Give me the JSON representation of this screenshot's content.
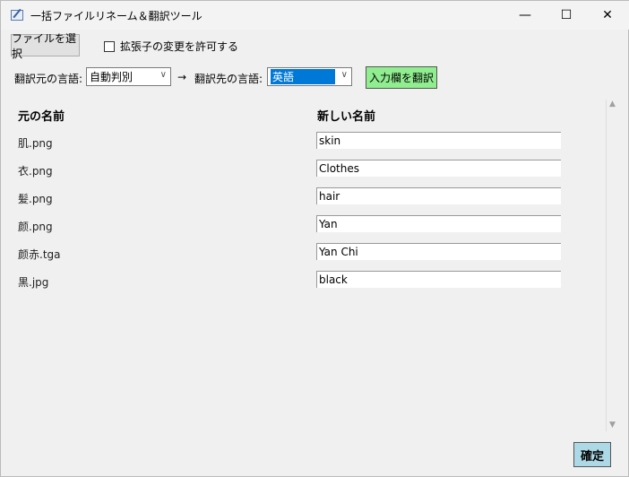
{
  "window": {
    "title": "一括ファイルリネーム＆翻訳ツール",
    "minimize": "—",
    "maximize": "☐",
    "close": "✕"
  },
  "toolbar": {
    "select_file": "ファイルを選択",
    "allow_ext_change": "拡張子の変更を許可する",
    "allow_ext_checked": false
  },
  "translate": {
    "source_label": "翻訳元の言語:",
    "source_value": "自動判別",
    "arrow": "→",
    "target_label": "翻訳先の言語:",
    "target_value": "英語",
    "translate_button": "入力欄を翻訳"
  },
  "table": {
    "header_original": "元の名前",
    "header_new": "新しい名前",
    "rows": [
      {
        "original": "肌.png",
        "new": "skin"
      },
      {
        "original": "衣.png",
        "new": "Clothes"
      },
      {
        "original": "髪.png",
        "new": "hair"
      },
      {
        "original": "颜.png",
        "new": "Yan"
      },
      {
        "original": "颜赤.tga",
        "new": "Yan Chi"
      },
      {
        "original": "黒.jpg",
        "new": "black"
      }
    ]
  },
  "confirm": "確定",
  "colors": {
    "translate_button": "#90ee90",
    "confirm_button": "#add8e6",
    "selection": "#0078d7"
  }
}
